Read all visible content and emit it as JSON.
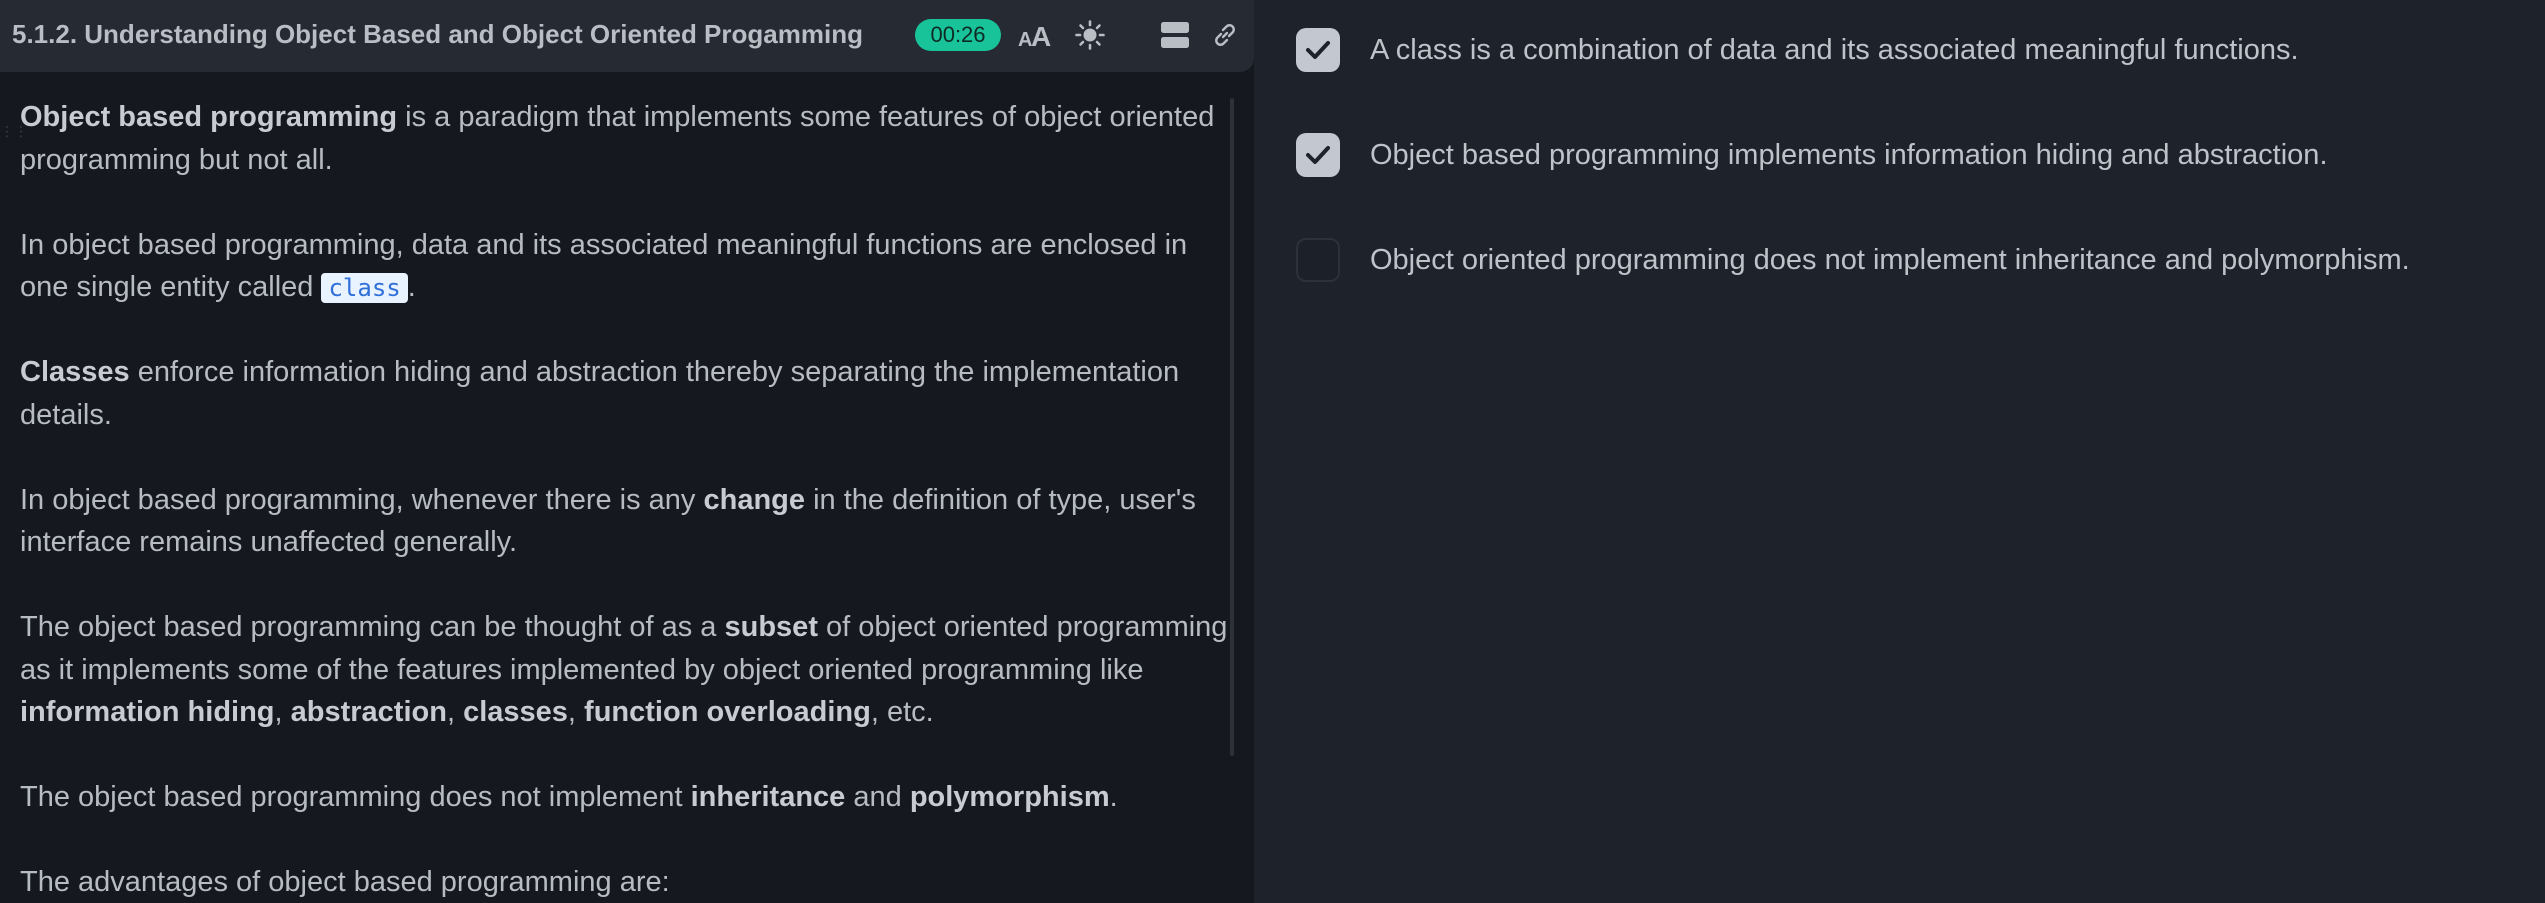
{
  "header": {
    "title": "5.1.2. Understanding Object Based and Object Oriented Progamming",
    "timer": "00:26"
  },
  "content": {
    "p1": {
      "b1": "Object based programming",
      "t1": " is a paradigm that implements some features of object oriented programming but not all."
    },
    "p2": {
      "t1": "In object based programming, data and its associated meaningful functions are enclosed in one single entity called ",
      "code": "class",
      "t2": "."
    },
    "p3": {
      "b1": "Classes",
      "t1": " enforce information hiding and abstraction thereby separating the implementation details."
    },
    "p4": {
      "t1": "In object based programming, whenever there is any ",
      "b1": "change",
      "t2": " in the definition of type, user's interface remains unaffected generally."
    },
    "p5": {
      "t1": "The object based programming can be thought of as a ",
      "b1": "subset",
      "t2": " of object oriented programming as it implements some of the features implemented by object oriented programming like ",
      "b2": "information hiding",
      "s1": ", ",
      "b3": "abstraction",
      "s2": ", ",
      "b4": "classes",
      "s3": ", ",
      "b5": "function overloading",
      "t3": ", etc."
    },
    "p6": {
      "t1": "The object based programming does not implement ",
      "b1": "inheritance",
      "t2": " and ",
      "b2": "polymorphism",
      "t3": "."
    },
    "p7": {
      "t1": "The advantages of object based programming are:"
    }
  },
  "options": [
    {
      "label": "A class is a combination of data and its associated meaningful functions.",
      "checked": true
    },
    {
      "label": "Object based programming implements information hiding and abstraction.",
      "checked": true
    },
    {
      "label": "Object oriented programming does not implement inheritance and polymorphism.",
      "checked": false
    }
  ],
  "icons": {
    "font_size": "font-size-icon",
    "theme": "sun-icon",
    "layout": "layout-icon",
    "link": "link-icon",
    "check": "check-icon"
  },
  "colors": {
    "timer_bg": "#19c39a",
    "checkbox_checked": "#c2c7d0",
    "code_text": "#2e6fd8"
  }
}
